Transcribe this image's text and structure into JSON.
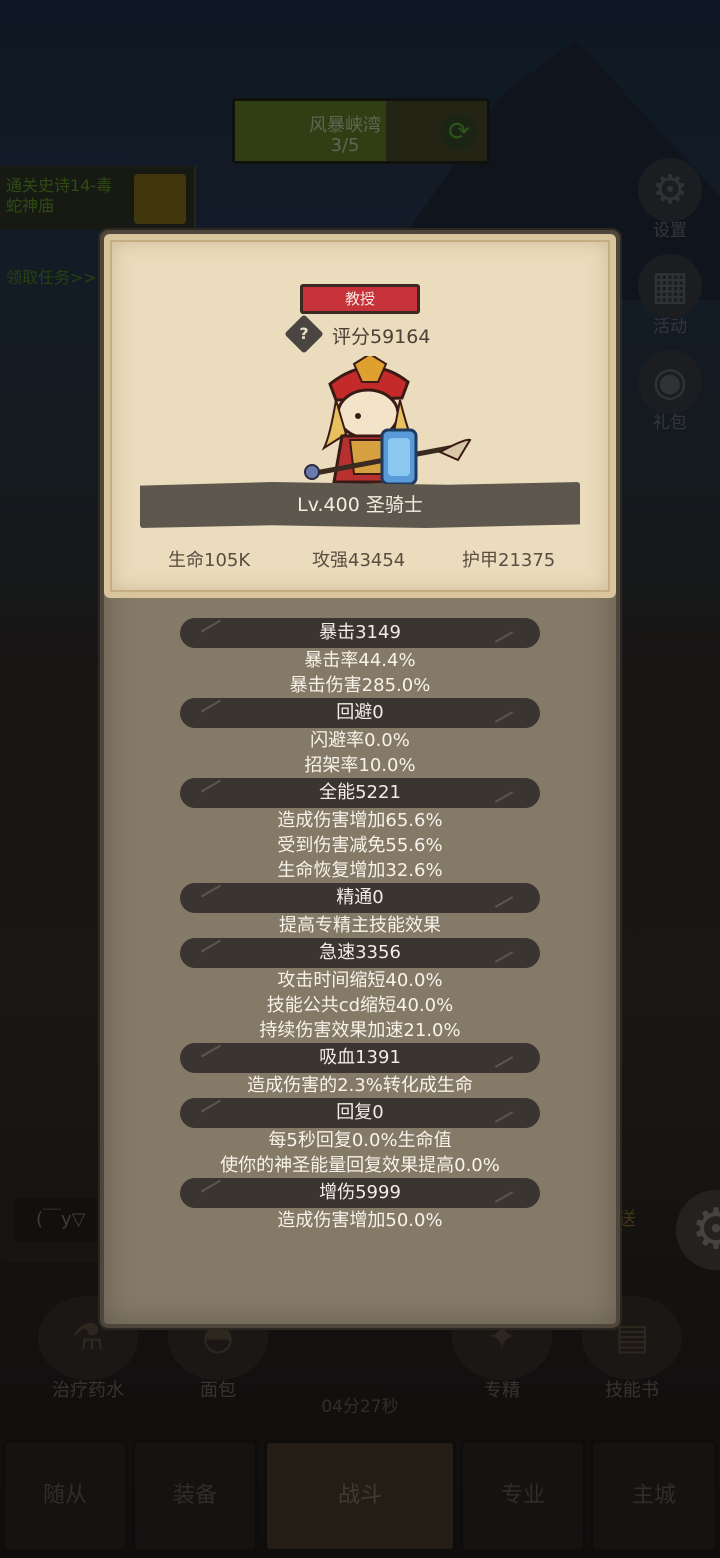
{
  "background": {
    "stage": {
      "name": "风暴峡湾",
      "progress": "3/5",
      "fill_fraction": 0.6
    },
    "quest": {
      "text": "通关史诗14-毒蛇神庙",
      "link": "领取任务>>"
    },
    "side_menu": [
      {
        "label": "设置",
        "icon": "gear-icon"
      },
      {
        "label": "活动",
        "icon": "calendar-icon"
      },
      {
        "label": "礼包",
        "icon": "gift-icon"
      }
    ],
    "chat": {
      "placeholder": "(￣y▽",
      "send_label": "发送"
    },
    "actions": [
      {
        "label": "治疗药水",
        "icon": "potion-icon"
      },
      {
        "label": "面包",
        "icon": "bread-icon"
      },
      {
        "label": "专精",
        "icon": "spec-icon"
      },
      {
        "label": "技能书",
        "icon": "book-icon"
      }
    ],
    "timer": "04分27秒",
    "nav_tabs": [
      {
        "label": "随从"
      },
      {
        "label": "装备"
      },
      {
        "label": "战斗",
        "active": true
      },
      {
        "label": "专业"
      },
      {
        "label": "主城"
      }
    ]
  },
  "panel": {
    "title_badge": "教授",
    "score": "评分59164",
    "hero_name": "Lv.400 圣骑士",
    "base_stats": {
      "hp": "生命105K",
      "attack": "攻强43454",
      "armor": "护甲21375"
    },
    "groups": [
      {
        "header": "暴击3149",
        "lines": [
          "暴击率44.4%",
          "暴击伤害285.0%"
        ]
      },
      {
        "header": "回避0",
        "lines": [
          "闪避率0.0%",
          "招架率10.0%"
        ]
      },
      {
        "header": "全能5221",
        "lines": [
          "造成伤害增加65.6%",
          "受到伤害减免55.6%",
          "生命恢复增加32.6%"
        ]
      },
      {
        "header": "精通0",
        "lines": [
          "提高专精主技能效果"
        ]
      },
      {
        "header": "急速3356",
        "lines": [
          "攻击时间缩短40.0%",
          "技能公共cd缩短40.0%",
          "持续伤害效果加速21.0%"
        ]
      },
      {
        "header": "吸血1391",
        "lines": [
          "造成伤害的2.3%转化成生命"
        ]
      },
      {
        "header": "回复0",
        "lines": [
          "每5秒回复0.0%生命值",
          "使你的神圣能量回复效果提高0.0%"
        ]
      },
      {
        "header": "增伤5999",
        "lines": [
          "造成伤害增加50.0%"
        ]
      }
    ]
  },
  "colors": {
    "panel_bg": "#857a68",
    "card_bg": "#eadcbc",
    "badge_red": "#c6323a",
    "header_dark": "#3a3530"
  }
}
